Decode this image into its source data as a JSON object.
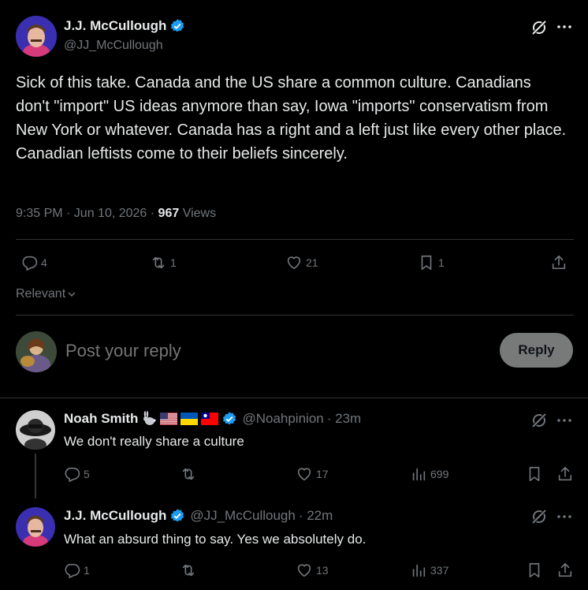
{
  "main_tweet": {
    "author_name": "J.J. McCullough",
    "handle": "@JJ_McCullough",
    "text": "Sick of this take. Canada and the US share a common culture. Canadians don't \"import\" US ideas anymore than say, Iowa \"imports\" conservatism from New York or whatever. Canada has a right and a left just like every other place. Canadian leftists come to their beliefs sincerely.",
    "time": "9:35 PM · Jun 10, 2026 · ",
    "views_count": "967",
    "views_label": " Views",
    "replies": "4",
    "reposts": "1",
    "likes": "21",
    "bookmarks": "1"
  },
  "sort_label": "Relevant",
  "reply_box": {
    "placeholder": "Post your reply",
    "button": "Reply"
  },
  "replies": [
    {
      "author_name": "Noah Smith",
      "emoji_badges": [
        "rabbit",
        "flag-us",
        "flag-ukraine",
        "flag-taiwan"
      ],
      "handle": "@Noahpinion",
      "time": " · 23m",
      "text": "We don't really share a culture",
      "replies": "5",
      "reposts": "",
      "likes": "17",
      "views": "699"
    },
    {
      "author_name": "J.J. McCullough",
      "handle": "@JJ_McCullough",
      "time": " · 22m",
      "text": "What an absurd thing to say. Yes we absolutely do.",
      "replies": "1",
      "reposts": "",
      "likes": "13",
      "views": "337"
    }
  ],
  "colors": {
    "accent": "#1d9bf0",
    "muted": "#71767b",
    "divider": "#2f3336",
    "background": "#000000"
  }
}
